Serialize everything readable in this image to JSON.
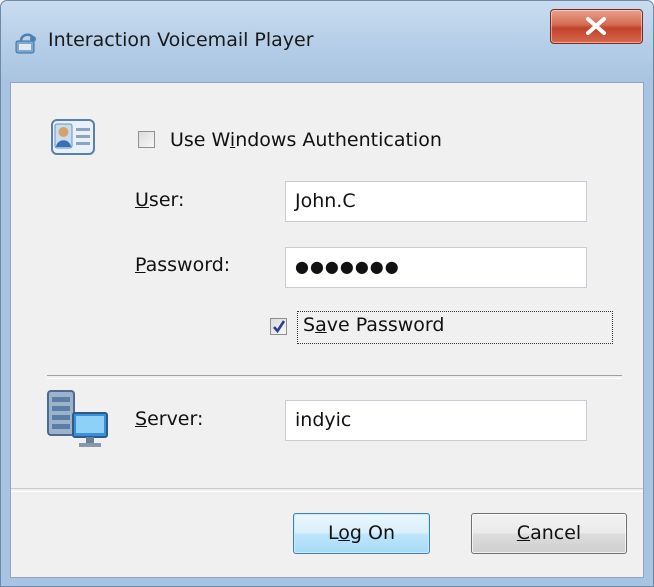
{
  "window": {
    "title": "Interaction Voicemail Player",
    "close_icon": "close-x-icon",
    "app_icon": "voicemail-app-icon"
  },
  "auth": {
    "icon": "user-card-icon",
    "use_windows_auth": {
      "label_pre": "Use W",
      "label_accel": "i",
      "label_post": "ndows Authentication",
      "checked": false
    },
    "user": {
      "label_accel": "U",
      "label_post": "ser:",
      "value": "John.C"
    },
    "password": {
      "label_accel": "P",
      "label_post": "assword:",
      "masked_value": "●●●●●●●"
    },
    "save_password": {
      "label_pre": "S",
      "label_accel": "a",
      "label_post": "ve Password",
      "checked": true
    }
  },
  "server": {
    "icon": "server-computer-icon",
    "label_accel": "S",
    "label_post": "erver:",
    "value": "indyic"
  },
  "buttons": {
    "logon": {
      "pre": "L",
      "accel": "o",
      "post": "g On"
    },
    "cancel": {
      "accel": "C",
      "post": "ancel"
    }
  }
}
